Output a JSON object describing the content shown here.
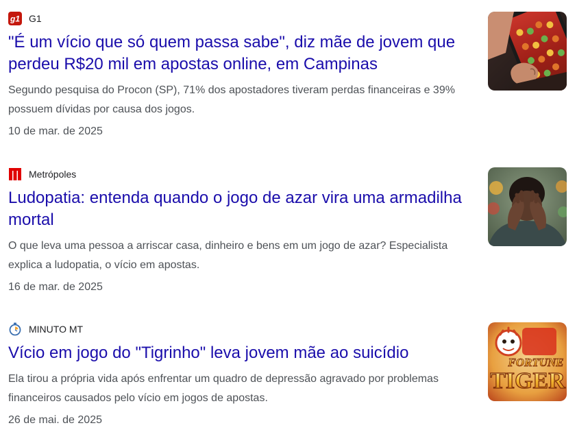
{
  "articles": [
    {
      "source": "G1",
      "source_icon": "g1-logo-icon",
      "source_color": "#c4170c",
      "headline": "\"É um vício que só quem passa sabe\", diz mãe de jovem que perdeu R$20 mil em apostas online, em Campinas",
      "snippet": "Segundo pesquisa do Procon (SP), 71% dos apostadores tiveram perdas financeiras e 39% possuem dívidas por causa dos jogos.",
      "date": "10 de mar. de 2025",
      "thumbnail": "hand-holding-phone-casino-game-image"
    },
    {
      "source": "Metrópoles",
      "source_icon": "metropoles-logo-icon",
      "source_color": "#e00000",
      "headline": "Ludopatia: entenda quando o jogo de azar vira uma armadilha mortal",
      "snippet": "O que leva uma pessoa a arriscar casa, dinheiro e bens em um jogo de azar? Especialista explica a ludopatia, o vício em apostas.",
      "date": "16 de mar. de 2025",
      "thumbnail": "distressed-man-hands-on-face-image"
    },
    {
      "source": "MINUTO MT",
      "source_icon": "minuto-mt-stopwatch-logo-icon",
      "source_color": "#3a6fb0",
      "headline": "Vício em jogo do \"Tigrinho\" leva jovem mãe ao suicídio",
      "snippet": "Ela tirou a própria vida após enfrentar um quadro de depressão agravado por problemas financeiros causados pelo vício em jogos de apostas.",
      "date": "26 de mai. de 2025",
      "thumbnail": "fortune-tiger-game-image",
      "thumbnail_text": {
        "line1": "FORTUNE",
        "line2": "TIGER"
      }
    }
  ],
  "colors": {
    "headline": "#1a0dab",
    "snippet": "#4d5156",
    "source_text": "#202124",
    "background": "#ffffff"
  }
}
